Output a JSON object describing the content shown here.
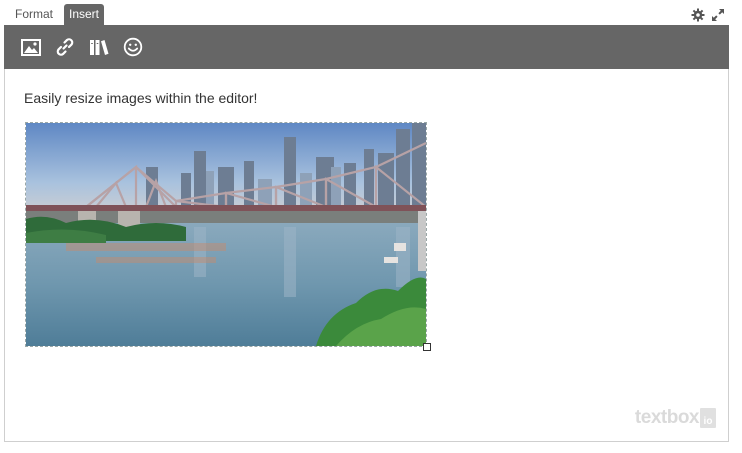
{
  "tabs": {
    "format_label": "Format",
    "insert_label": "Insert",
    "active": "Insert"
  },
  "top_actions": {
    "settings_icon": "gear-icon",
    "fullscreen_icon": "expand-icon"
  },
  "toolbar": {
    "buttons": [
      {
        "icon": "image-icon"
      },
      {
        "icon": "link-icon"
      },
      {
        "icon": "library-icon"
      },
      {
        "icon": "emoji-icon"
      }
    ],
    "background": "#666666"
  },
  "editor": {
    "text": "Easily resize images within the editor!",
    "image_subject": "city skyline with bridge over river"
  },
  "branding": {
    "logo_text": "textbox",
    "logo_suffix": "io"
  },
  "colors": {
    "toolbar_bg": "#666666",
    "tab_active_bg": "#666666",
    "icon_color": "#ffffff",
    "border": "#cfcfcf"
  }
}
